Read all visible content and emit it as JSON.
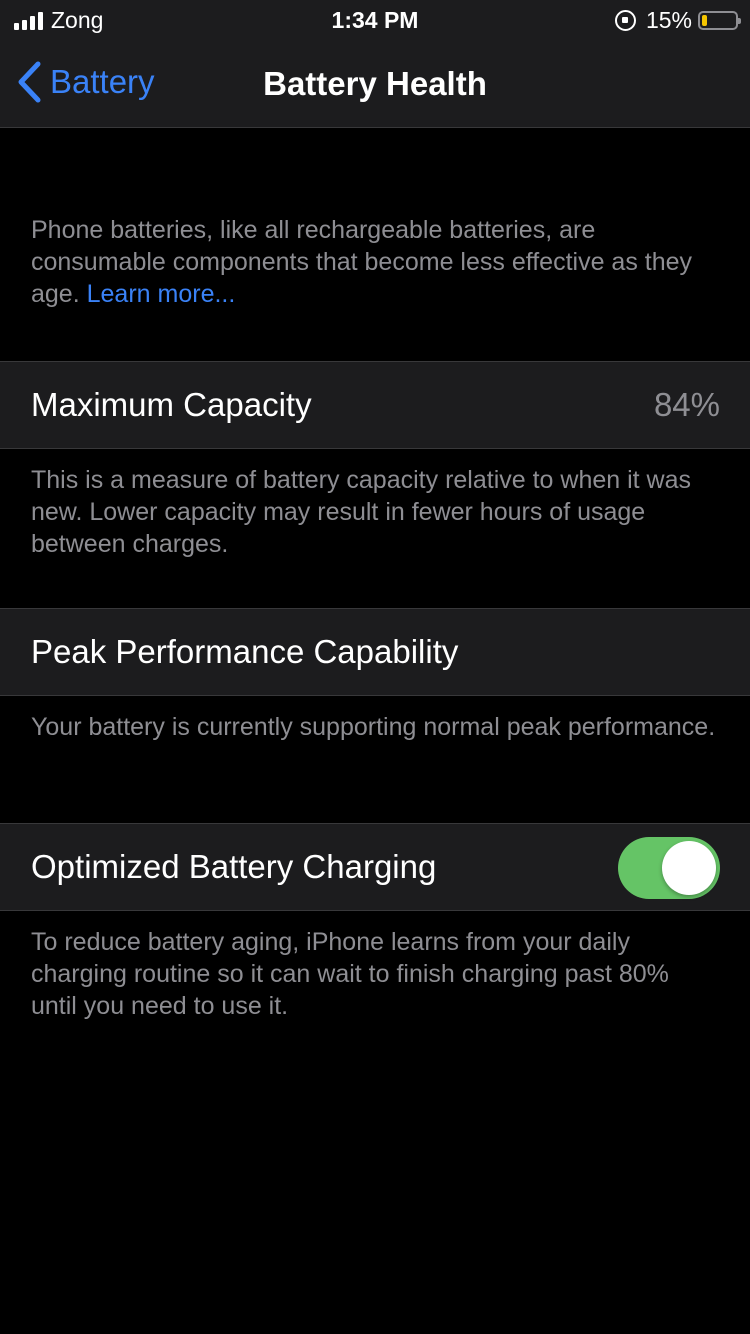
{
  "status_bar": {
    "carrier": "Zong",
    "time": "1:34 PM",
    "battery_percent": "15%",
    "battery_level": 0.15,
    "icons": [
      "signal-bars-icon",
      "rotation-lock-icon",
      "battery-icon"
    ]
  },
  "nav": {
    "back_label": "Battery",
    "title": "Battery Health"
  },
  "intro": {
    "text": "Phone batteries, like all rechargeable batteries, are consumable components that become less effective as they age.",
    "link": "Learn more..."
  },
  "maximum_capacity": {
    "label": "Maximum Capacity",
    "value": "84%",
    "description": "This is a measure of battery capacity relative to when it was new. Lower capacity may result in fewer hours of usage between charges."
  },
  "peak_performance": {
    "label": "Peak Performance Capability",
    "description": "Your battery is currently supporting normal peak performance."
  },
  "optimized_charging": {
    "label": "Optimized Battery Charging",
    "enabled": true,
    "description": "To reduce battery aging, iPhone learns from your daily charging routine so it can wait to finish charging past 80% until you need to use it."
  },
  "colors": {
    "accent": "#3a82f7",
    "toggle_on": "#65c466",
    "battery_low": "#f5c500"
  }
}
